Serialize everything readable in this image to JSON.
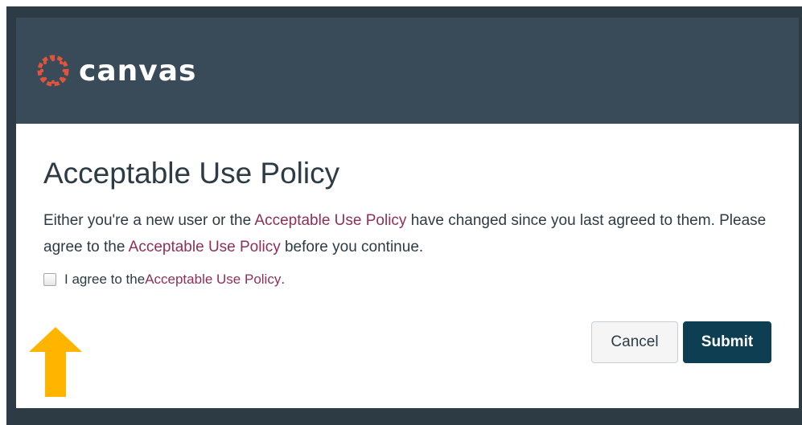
{
  "header": {
    "logo_text": "canvas",
    "logo_icon": "canvas-logo-icon",
    "brand_color": "#e0543c",
    "background": "#394b58"
  },
  "dialog": {
    "title": "Acceptable Use Policy",
    "message": {
      "part1": "Either you're a new user or the ",
      "link1": "Acceptable Use Policy",
      "part2": " have changed since you last agreed to them. Please agree to the ",
      "link2": "Acceptable Use Policy",
      "part3": " before you continue."
    },
    "agree": {
      "prefix": "I agree to the ",
      "link": "Acceptable Use Policy",
      "suffix": ".",
      "checked": false
    },
    "buttons": {
      "cancel_label": "Cancel",
      "submit_label": "Submit"
    }
  },
  "annotation": {
    "arrow_color": "#ffb400",
    "arrow_icon": "up-arrow-icon"
  },
  "colors": {
    "link": "#8d2f5a",
    "submit": "#0e3e52"
  }
}
